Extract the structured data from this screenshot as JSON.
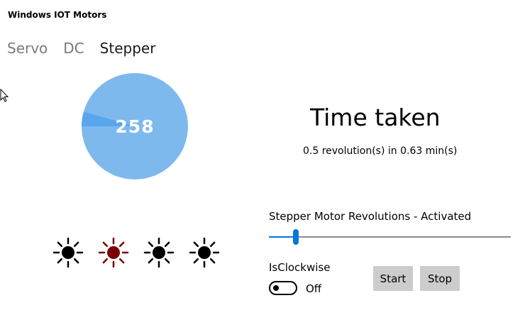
{
  "app": {
    "title": "Windows IOT Motors"
  },
  "tabs": [
    {
      "label": "Servo",
      "active": false
    },
    {
      "label": "DC",
      "active": false
    },
    {
      "label": "Stepper",
      "active": true
    }
  ],
  "dial": {
    "value": "258",
    "value_degrees": 258,
    "fill_color": "#7eb9ee",
    "indicator_color": "#5aa6ec"
  },
  "time": {
    "title": "Time taken",
    "detail": "0.5 revolution(s) in 0.63 min(s)"
  },
  "leds": [
    {
      "state": "off",
      "color": "#000000"
    },
    {
      "state": "on",
      "color": "#7a0000"
    },
    {
      "state": "off",
      "color": "#000000"
    },
    {
      "state": "off",
      "color": "#000000"
    }
  ],
  "slider": {
    "label": "Stepper Motor Revolutions - Activated",
    "value_fraction": 0.11,
    "accent_color": "#0078d7"
  },
  "direction": {
    "label": "IsClockwise",
    "state_label": "Off",
    "is_on": false
  },
  "controls": {
    "start_label": "Start",
    "stop_label": "Stop"
  }
}
